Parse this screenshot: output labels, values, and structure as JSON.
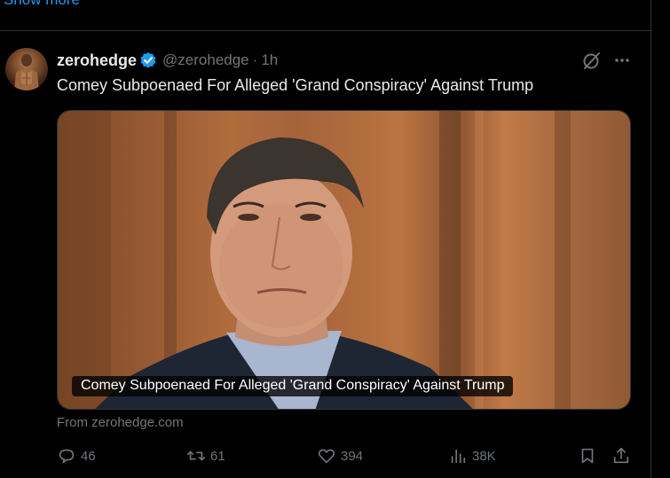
{
  "top": {
    "show_more": "Show more"
  },
  "tweet": {
    "display_name": "zerohedge",
    "handle": "@zerohedge",
    "separator": "·",
    "time": "1h",
    "text": "Comey Subpoenaed For Alleged 'Grand Conspiracy' Against Trump",
    "card": {
      "caption": "Comey Subpoenaed For Alleged 'Grand Conspiracy' Against Trump",
      "source": "From zerohedge.com"
    },
    "actions": {
      "replies": "46",
      "reposts": "61",
      "likes": "394",
      "views": "38K"
    }
  },
  "icons": {
    "verified": "verified-badge-icon",
    "grok": "grok-icon",
    "more": "more-icon",
    "reply": "reply-icon",
    "repost": "repost-icon",
    "like": "heart-icon",
    "views": "views-icon",
    "bookmark": "bookmark-icon",
    "share": "share-icon"
  },
  "colors": {
    "background": "#000000",
    "text_primary": "#e7e9ea",
    "text_secondary": "#71767b",
    "accent": "#1d9bf0",
    "border": "#2f3336"
  }
}
